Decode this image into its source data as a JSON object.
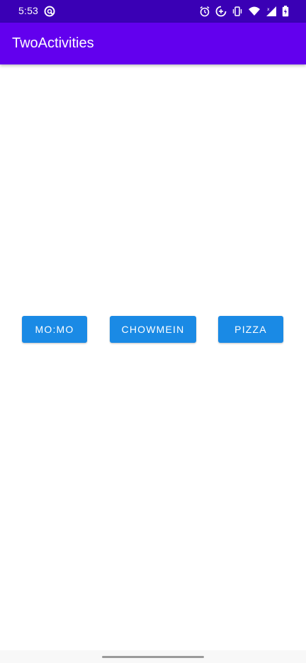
{
  "status_bar": {
    "time": "5:53",
    "background": "#3a00b5",
    "icons": [
      "notification-icon",
      "alarm-icon",
      "data-saver-icon",
      "vibrate-icon",
      "wifi-icon",
      "cell-signal-icon",
      "battery-charging-icon"
    ]
  },
  "app_bar": {
    "title": "TwoActivities",
    "background": "#6200ee"
  },
  "buttons": {
    "momo_label": "MO:MO",
    "chowmein_label": "CHOWMEIN",
    "pizza_label": "PIZZA",
    "color": "#1a8ae5"
  }
}
